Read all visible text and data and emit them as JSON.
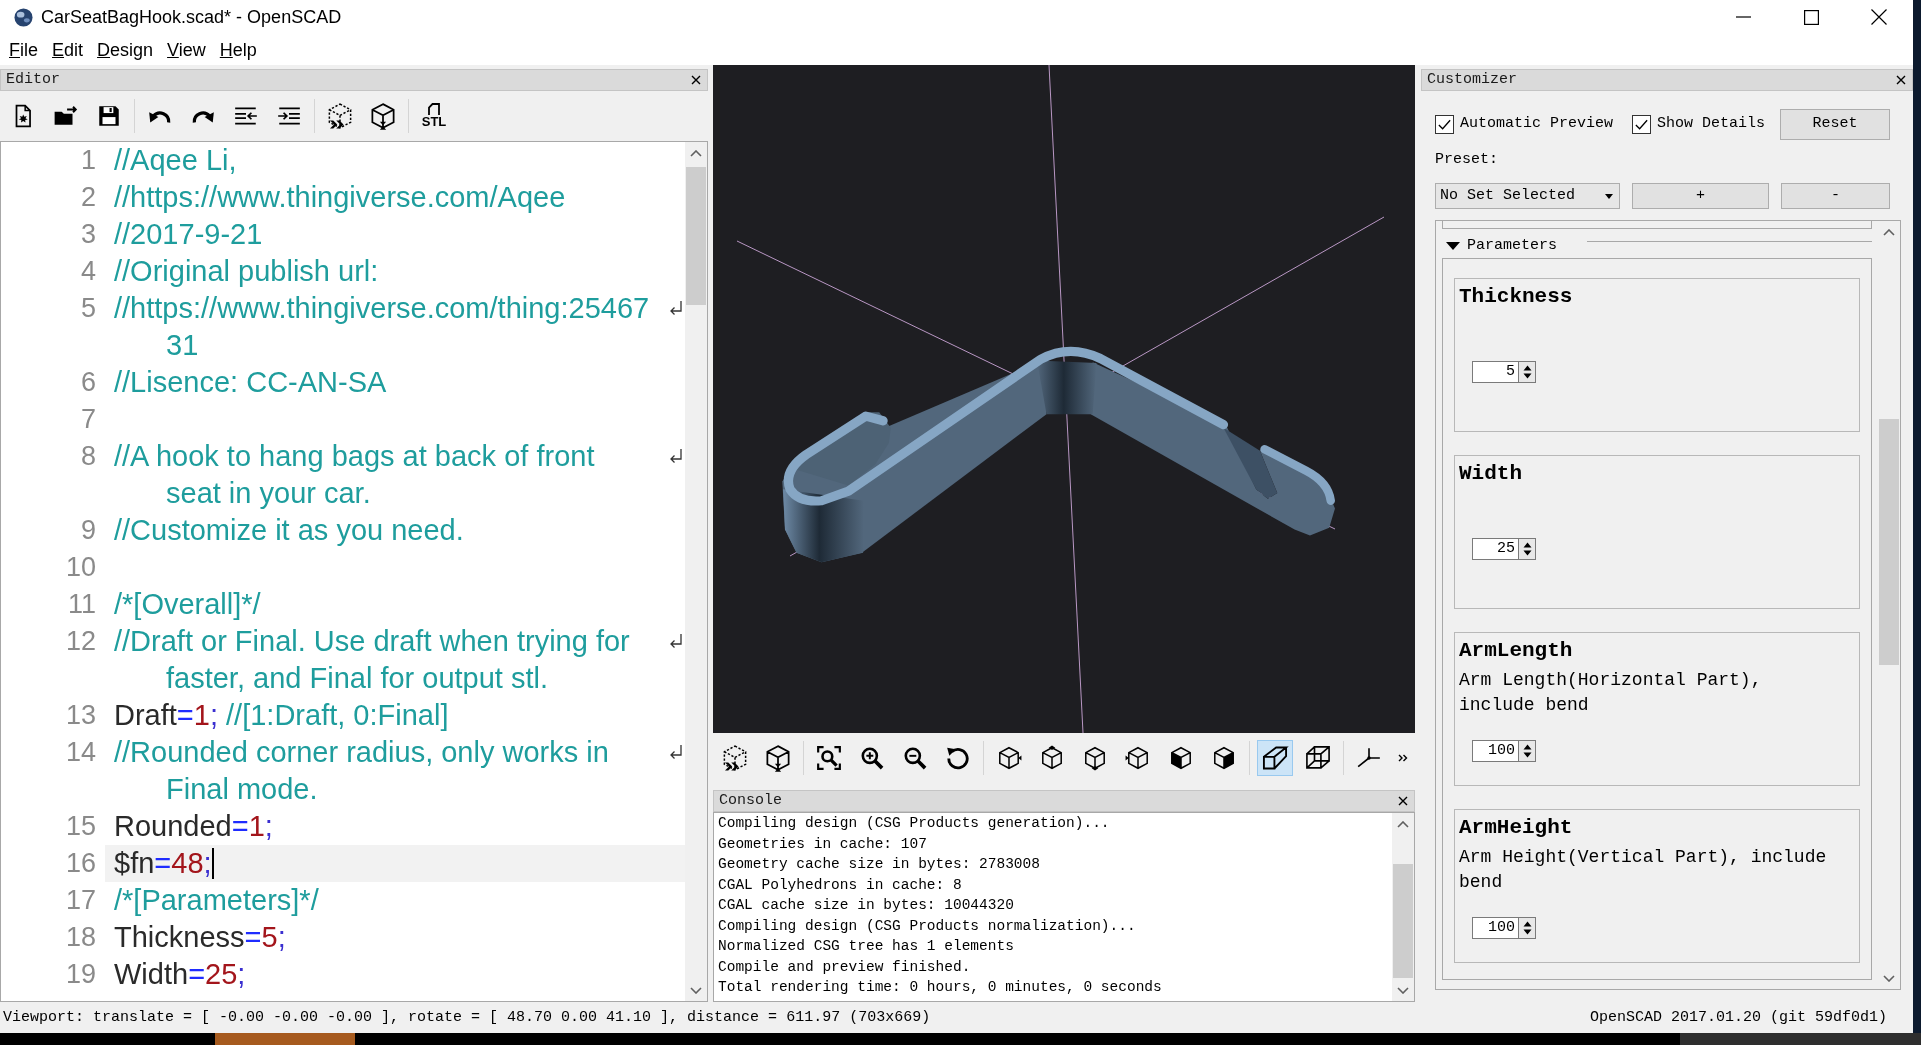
{
  "window": {
    "title": "CarSeatBagHook.scad* - OpenSCAD"
  },
  "menu": [
    "File",
    "Edit",
    "Design",
    "View",
    "Help"
  ],
  "editor": {
    "title": "Editor",
    "export_label": "STL",
    "lines": [
      {
        "number": "1",
        "current": false,
        "rows": [
          [
            {
              "kind": "comment",
              "text": "//Aqee Li,"
            }
          ]
        ]
      },
      {
        "number": "2",
        "current": false,
        "rows": [
          [
            {
              "kind": "comment",
              "text": "//https://www.thingiverse.com/Aqee"
            }
          ]
        ]
      },
      {
        "number": "3",
        "current": false,
        "rows": [
          [
            {
              "kind": "comment",
              "text": "//2017-9-21"
            }
          ]
        ]
      },
      {
        "number": "4",
        "current": false,
        "rows": [
          [
            {
              "kind": "comment",
              "text": "//Original publish url:"
            }
          ]
        ]
      },
      {
        "number": "5",
        "current": false,
        "rows": [
          [
            {
              "kind": "comment",
              "text": "//https://www.thingiverse.com/thing:25467"
            }
          ],
          [
            {
              "kind": "comment",
              "text": "31"
            }
          ]
        ]
      },
      {
        "number": "6",
        "current": false,
        "rows": [
          [
            {
              "kind": "comment",
              "text": "//Lisence: CC-AN-SA"
            }
          ]
        ]
      },
      {
        "number": "7",
        "current": false
      },
      {
        "number": "8",
        "current": false,
        "rows": [
          [
            {
              "kind": "comment",
              "text": "//A hook to hang bags at back of front"
            }
          ],
          [
            {
              "kind": "comment",
              "text": "seat in your car."
            }
          ]
        ]
      },
      {
        "number": "9",
        "current": false,
        "rows": [
          [
            {
              "kind": "comment",
              "text": "//Customize it as you need."
            }
          ]
        ]
      },
      {
        "number": "10",
        "current": false
      },
      {
        "number": "11",
        "current": false,
        "rows": [
          [
            {
              "kind": "comment",
              "text": "/*[Overall]*/"
            }
          ]
        ]
      },
      {
        "number": "12",
        "current": false,
        "rows": [
          [
            {
              "kind": "comment",
              "text": "//Draft or Final. Use draft when trying for"
            }
          ],
          [
            {
              "kind": "comment",
              "text": "faster, and Final for output stl."
            }
          ]
        ]
      },
      {
        "number": "13",
        "current": false,
        "rows": [
          [
            {
              "kind": "text",
              "text": "Draft"
            },
            {
              "kind": "operator",
              "text": "="
            },
            {
              "kind": "number",
              "text": "1"
            },
            {
              "kind": "punct",
              "text": ";"
            },
            {
              "kind": "comment",
              "text": " //[1:Draft, 0:Final]"
            }
          ]
        ]
      },
      {
        "number": "14",
        "current": false,
        "rows": [
          [
            {
              "kind": "comment",
              "text": "//Rounded corner radius, only works in"
            }
          ],
          [
            {
              "kind": "comment",
              "text": "Final mode."
            }
          ]
        ]
      },
      {
        "number": "15",
        "current": false,
        "rows": [
          [
            {
              "kind": "text",
              "text": "Rounded"
            },
            {
              "kind": "operator",
              "text": "="
            },
            {
              "kind": "number",
              "text": "1"
            },
            {
              "kind": "punct",
              "text": ";"
            }
          ]
        ]
      },
      {
        "number": "16",
        "current": true,
        "rows": [
          [
            {
              "kind": "text",
              "text": "$fn"
            },
            {
              "kind": "operator",
              "text": "="
            },
            {
              "kind": "number",
              "text": "48"
            },
            {
              "kind": "punct",
              "text": ";"
            }
          ]
        ]
      },
      {
        "number": "17",
        "current": false,
        "rows": [
          [
            {
              "kind": "comment",
              "text": "/*[Parameters]*/"
            }
          ]
        ]
      },
      {
        "number": "18",
        "current": false,
        "rows": [
          [
            {
              "kind": "text",
              "text": "Thickness"
            },
            {
              "kind": "operator",
              "text": "="
            },
            {
              "kind": "number",
              "text": "5"
            },
            {
              "kind": "punct",
              "text": ";"
            }
          ]
        ]
      },
      {
        "number": "19",
        "current": false,
        "rows": [
          [
            {
              "kind": "text",
              "text": "Width"
            },
            {
              "kind": "operator",
              "text": "="
            },
            {
              "kind": "number",
              "text": "25"
            },
            {
              "kind": "punct",
              "text": ";"
            }
          ]
        ]
      }
    ]
  },
  "viewer_toolbar": {
    "projection": [
      {
        "kind": "perspective",
        "selected": true
      },
      {
        "kind": "orthogonal",
        "selected": false
      }
    ]
  },
  "console": {
    "title": "Console",
    "lines": [
      "Compiling design (CSG Products generation)...",
      "Geometries in cache: 107",
      "Geometry cache size in bytes: 2783008",
      "CGAL Polyhedrons in cache: 8",
      "CGAL cache size in bytes: 10044320",
      "Compiling design (CSG Products normalization)...",
      "Normalized CSG tree has 1 elements",
      "Compile and preview finished.",
      "Total rendering time: 0 hours, 0 minutes, 0 seconds"
    ]
  },
  "customizer": {
    "title": "Customizer",
    "automatic_preview": {
      "label": "Automatic Preview",
      "checked": true
    },
    "show_details": {
      "label": "Show Details",
      "checked": true
    },
    "reset_button": "Reset",
    "preset_label": "Preset:",
    "preset": {
      "value": "No Set Selected"
    },
    "add_button": "+",
    "remove_button": "-",
    "group": {
      "title": "Parameters",
      "expanded": true,
      "parameters": [
        {
          "name": "Thickness",
          "value": "5"
        },
        {
          "name": "Width",
          "value": "25"
        },
        {
          "name": "ArmLength",
          "description": "Arm Length(Horizontal Part), include bend",
          "value": "100"
        },
        {
          "name": "ArmHeight",
          "description": "Arm Height(Vertical Part), include bend",
          "value": "100"
        }
      ]
    }
  },
  "status_bar": {
    "viewport": "Viewport: translate = [ -0.00 -0.00 -0.00 ], rotate = [ 48.70 0.00 41.10 ], distance = 611.97 (703x669)",
    "version": "OpenSCAD 2017.01.20 (git 59df0d1)"
  }
}
